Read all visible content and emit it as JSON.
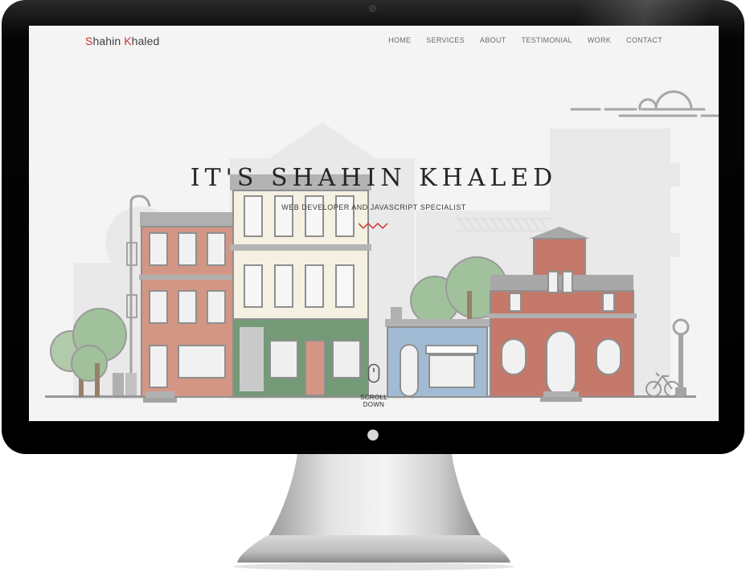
{
  "site": {
    "brand_first_initial": "S",
    "brand_first_rest": "hahin ",
    "brand_last_initial": "K",
    "brand_last_rest": "haled"
  },
  "nav": {
    "items": [
      "HOME",
      "SERVICES",
      "ABOUT",
      "TESTIMONIAL",
      "WORK",
      "CONTACT"
    ]
  },
  "hero": {
    "title": "IT'S SHAHIN KHALED",
    "subtitle": "WEB DEVELOPER AND JAVASCRIPT SPECIALIST",
    "scroll_label": "SCROLL DOWN"
  },
  "icons": {
    "camera": "camera-icon",
    "apple": "apple-logo-icon",
    "mouse": "mouse-scroll-icon",
    "zigzag": "zigzag-divider-icon"
  },
  "colors": {
    "accent": "#d32f2f",
    "screen_bg": "#f4f4f4",
    "brick": "#c8755f",
    "cream": "#f5f0dc",
    "green": "#3f7a45",
    "blue": "#7fa6c8",
    "dark_brick": "#b4503e",
    "tree": "#8ab383"
  }
}
